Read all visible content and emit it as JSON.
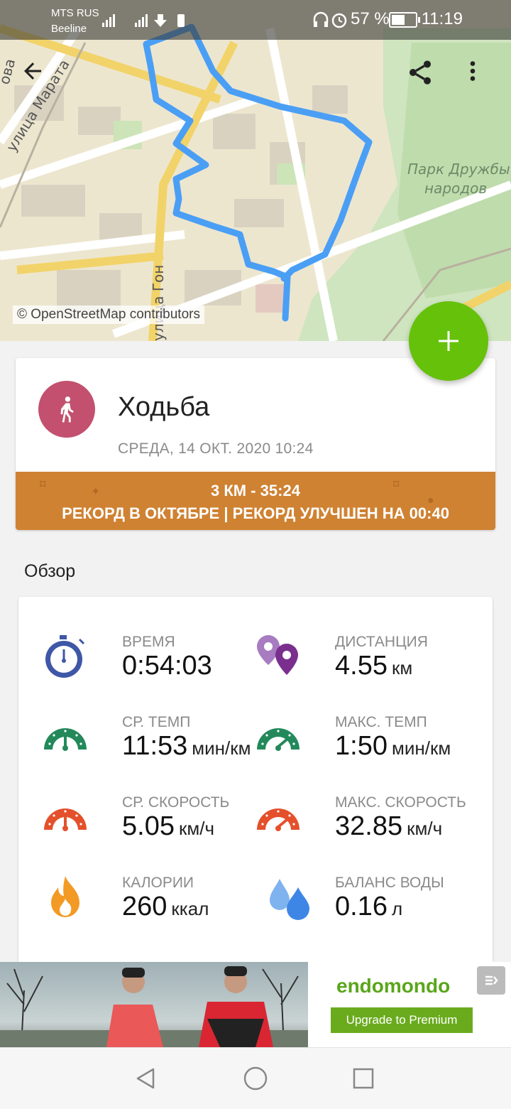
{
  "status_bar": {
    "carrier_1": "MTS RUS",
    "carrier_2": "Beeline",
    "battery": "57 %",
    "time": "11:19"
  },
  "map": {
    "street_1": "улица Марата",
    "street_2": "улица Гон",
    "street_3": "ова",
    "park_line1": "Парк Дружбы",
    "park_line2": "народов",
    "credit": "© OpenStreetMap contributors",
    "route_color": "#4a9ff5"
  },
  "toolbar": {
    "back_icon": "arrow-left-icon",
    "share_icon": "share-icon",
    "more_icon": "more-vert-icon"
  },
  "fab": {
    "label": "+",
    "color": "#66c10a"
  },
  "workout": {
    "sport": "Ходьба",
    "date": "СРЕДА, 14 ОКТ. 2020 10:24",
    "avatar_color": "#c2506e",
    "record_line1": "3 КМ  -  35:24",
    "record_line2": "РЕКОРД В ОКТЯБРЕ  |  РЕКОРД УЛУЧШЕН НА 00:40",
    "record_color": "#cf8232"
  },
  "overview": {
    "title": "Обзор",
    "stats": [
      {
        "label": "ВРЕМЯ",
        "value": "0:54:03",
        "unit": "",
        "icon": "stopwatch-icon"
      },
      {
        "label": "ДИСТАНЦИЯ",
        "value": "4.55",
        "unit": "км",
        "icon": "map-pins-icon"
      },
      {
        "label": "СР. ТЕМП",
        "value": "11:53",
        "unit": "мин/км",
        "icon": "avg-pace-gauge-icon"
      },
      {
        "label": "МАКС. ТЕМП",
        "value": "1:50",
        "unit": "мин/км",
        "icon": "max-pace-gauge-icon"
      },
      {
        "label": "СР. СКОРОСТЬ",
        "value": "5.05",
        "unit": "км/ч",
        "icon": "avg-speed-gauge-icon"
      },
      {
        "label": "МАКС. СКОРОСТЬ",
        "value": "32.85",
        "unit": "км/ч",
        "icon": "max-speed-gauge-icon"
      },
      {
        "label": "КАЛОРИИ",
        "value": "260",
        "unit": "ккал",
        "icon": "flame-icon"
      },
      {
        "label": "БАЛАНС ВОДЫ",
        "value": "0.16",
        "unit": "л",
        "icon": "water-drops-icon"
      }
    ]
  },
  "ad": {
    "brand": "endomondo",
    "button": "Upgrade to Premium"
  }
}
